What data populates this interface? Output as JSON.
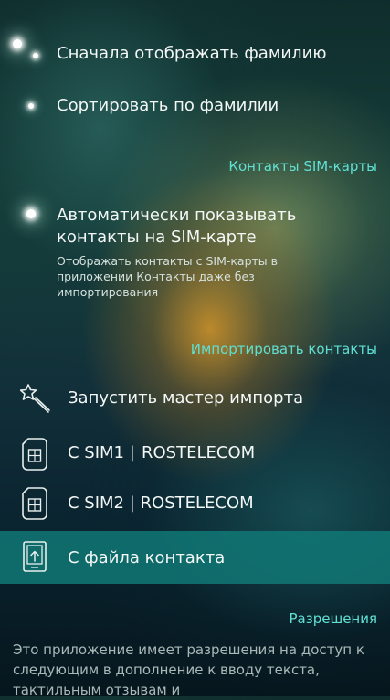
{
  "display": {
    "surname_first_label": "Сначала отображать фамилию",
    "sort_by_surname_label": "Сортировать по фамилии"
  },
  "sim_contacts": {
    "header": "Контакты SIM-карты",
    "auto_show_title": "Автоматически показывать контакты на SIM-карте",
    "auto_show_desc": "Отображать контакты с SIM-карты в приложении Контакты даже без импортирования"
  },
  "import": {
    "header": "Импортировать контакты",
    "wizard_label": "Запустить мастер импорта",
    "sim1_label": "С SIM1 |",
    "sim1_operator": "ROSTELECOM",
    "sim2_label": "С SIM2 | ROSTELECOM",
    "file_label": "С файла контакта"
  },
  "permissions": {
    "header": "Разрешения",
    "text": "Это приложение имеет разрешения на доступ к следующим в дополнение к вводу текста, тактильным отзывам и"
  },
  "icons": {
    "wizard": "magic-wand-icon",
    "sim1": "sim-card-icon",
    "sim2": "sim-card-icon",
    "file": "contact-file-icon"
  },
  "colors": {
    "accent": "#5fe0d3",
    "highlight": "#107876"
  }
}
